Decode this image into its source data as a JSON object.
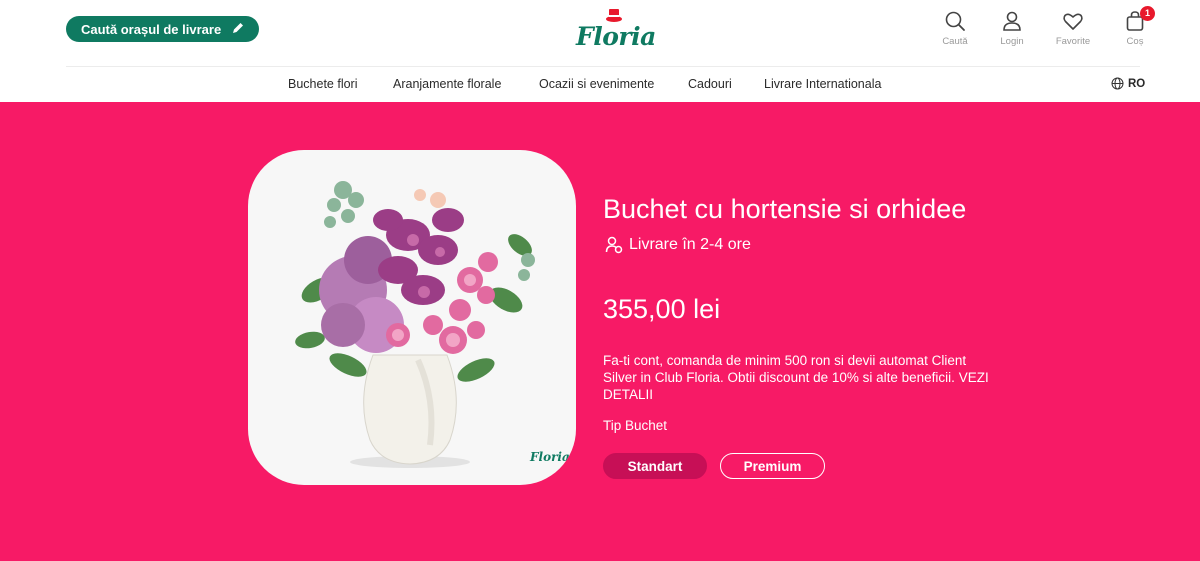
{
  "header": {
    "city_button_label": "Caută orașul de livrare",
    "logo_text": "Floria",
    "icons": [
      {
        "name": "search-icon",
        "label": "Caută"
      },
      {
        "name": "user-icon",
        "label": "Login"
      },
      {
        "name": "heart-icon",
        "label": "Favorite"
      },
      {
        "name": "bag-icon",
        "label": "Coș"
      }
    ],
    "cart_count": "1"
  },
  "nav": {
    "items": [
      "Buchete flori",
      "Aranjamente florale",
      "Ocazii si evenimente",
      "Cadouri",
      "Livrare Internationala"
    ],
    "language": "RO"
  },
  "product": {
    "title": "Buchet cu hortensie si orhidee",
    "delivery": "Livrare în 2-4 ore",
    "price": "355,00 lei",
    "promo_text": "Fa-ti cont, comanda de minim 500 ron si devii automat Client Silver in Club Floria. Obtii discount de 10% si alte beneficii.",
    "promo_link": "VEZI DETALII",
    "type_label": "Tip Buchet",
    "types": [
      "Standart",
      "Premium"
    ],
    "selected_type": "Standart",
    "image_logo": "Floria"
  },
  "colors": {
    "brand_green": "#0f7a61",
    "hero_pink": "#f71a66",
    "selected_button": "#c70f56",
    "badge_red": "#e8192c"
  }
}
